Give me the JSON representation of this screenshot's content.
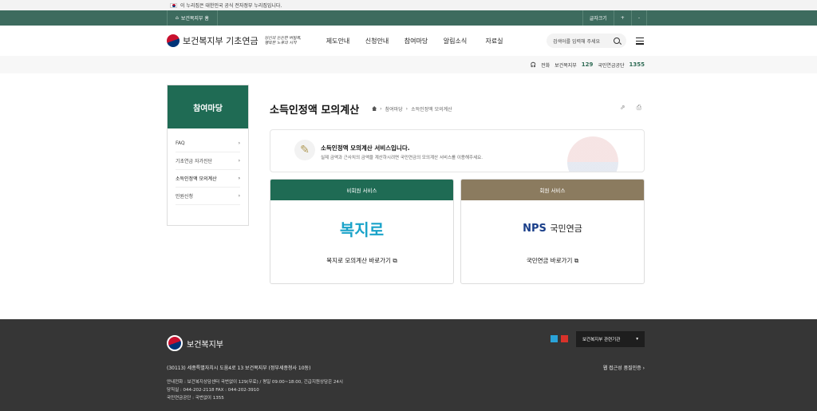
{
  "gov_bar": {
    "text": "이 누리집은 대한민국 공식 전자정부 누리집입니다."
  },
  "util_bar": {
    "home_link": "보건복지부 홈",
    "font_size": "글자크기",
    "plus": "+",
    "minus": "-"
  },
  "header": {
    "logo_text": "보건복지부 기초연금",
    "logo_script_1": "당신의 든든한 버팀목,",
    "logo_script_2": "행복한 노후의 시작",
    "nav": [
      "제도안내",
      "신청안내",
      "참여마당",
      "알림소식",
      "자료실"
    ],
    "search_placeholder": "검색어를 입력해 주세요"
  },
  "contact": {
    "phone_label": "전화",
    "mohw_label": "보건복지부",
    "mohw_number": "129",
    "nps_label": "국민연금공단",
    "nps_number": "1355"
  },
  "lnb": {
    "title": "참여마당",
    "items": [
      {
        "label": "FAQ",
        "active": false
      },
      {
        "label": "기초연금 자가진단",
        "active": false
      },
      {
        "label": "소득인정액 모의계산",
        "active": true
      },
      {
        "label": "민원신청",
        "active": false
      }
    ]
  },
  "content": {
    "title": "소득인정액 모의계산",
    "breadcrumb": [
      "참여마당",
      "소득인정액 모의계산"
    ],
    "info_title": "소득인정액 모의계산 서비스입니다.",
    "info_desc": "실제 금액과 근사치의 금액을 계산하시려면 국민연금의 모의계산 서비스를 이용해주세요.",
    "cards": [
      {
        "header": "비회원 서비스",
        "header_color": "#1f6b54",
        "logo": "복지로",
        "link": "복지로 모의계산 바로가기"
      },
      {
        "header": "회원 서비스",
        "header_color": "#8b7b5f",
        "logo_nps": "NPS",
        "logo_kor": "국민연금",
        "link": "국민연금 바로가기"
      }
    ]
  },
  "footer": {
    "logo_text": "보건복지부",
    "related_select": "보건복지부 관련기관",
    "address": "(30113) 세종특별자치시 도움4로 13 보건복지부 (정부세종청사 10동)",
    "accessibility": "웹 접근성 품질인증",
    "lines": [
      "안내전화 : 보건복지상담센터 국번없이 129(무료) / 평일 09:00~18:00, 긴급지원상담은 24시",
      "당직실 : 044-202-2118    FAX : 044-202-3910",
      "국민연금공단 : 국번없이 1355"
    ]
  },
  "colors": {
    "primary": "#1f6b54",
    "util_bar": "#3d6b5e",
    "member": "#8b7b5f",
    "footer": "#363636"
  }
}
